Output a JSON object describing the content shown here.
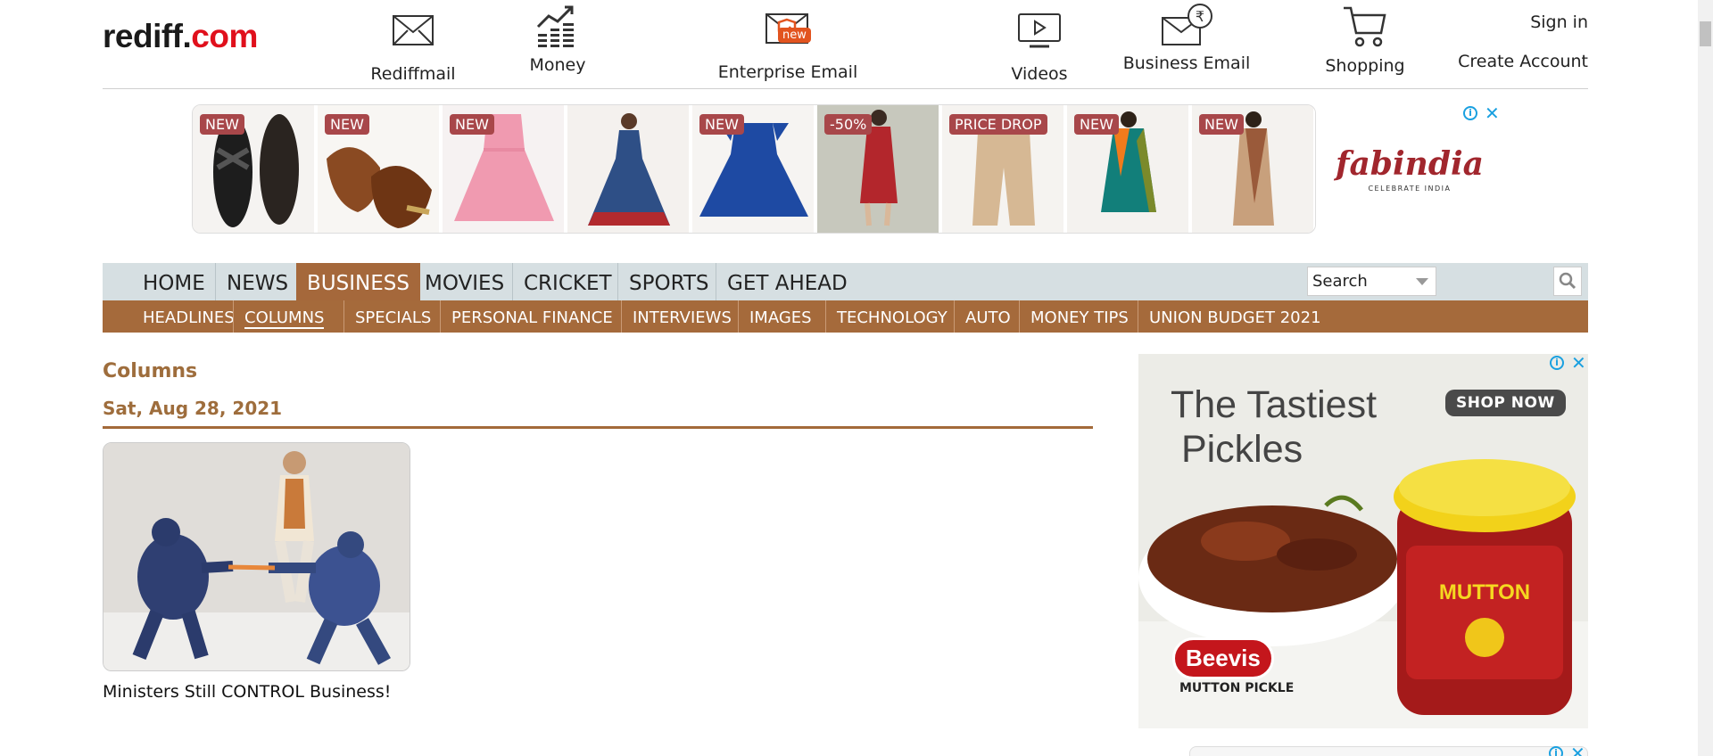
{
  "logo": {
    "part1": "rediff.",
    "part2": "com"
  },
  "header_nav": [
    {
      "label": "Rediffmail",
      "icon": "mail-icon"
    },
    {
      "label": "Money",
      "icon": "money-chart-icon"
    },
    {
      "label": "Enterprise Email",
      "icon": "enterprise-email-icon",
      "badge": "new"
    },
    {
      "label": "Videos",
      "icon": "video-icon"
    },
    {
      "label": "Business Email",
      "icon": "business-email-icon"
    },
    {
      "label": "Shopping",
      "icon": "cart-icon"
    }
  ],
  "account": {
    "signin": "Sign in",
    "create": "Create Account"
  },
  "top_ad": {
    "brand": "fabindia",
    "brand_sub": "CELEBRATE INDIA",
    "tiles": [
      {
        "tag": "NEW",
        "item": "sandals"
      },
      {
        "tag": "NEW",
        "item": "juttis"
      },
      {
        "tag": "NEW",
        "item": "girls-frock"
      },
      {
        "tag": "",
        "item": "anarkali"
      },
      {
        "tag": "NEW",
        "item": "blue-dress"
      },
      {
        "tag": "-50%",
        "item": "red-kurta"
      },
      {
        "tag": "PRICE DROP",
        "item": "trousers"
      },
      {
        "tag": "NEW",
        "item": "dupatta-outfit"
      },
      {
        "tag": "NEW",
        "item": "saree"
      }
    ]
  },
  "main_nav": [
    "HOME",
    "NEWS",
    "BUSINESS",
    "MOVIES",
    "CRICKET",
    "SPORTS",
    "GET AHEAD"
  ],
  "main_nav_active": "BUSINESS",
  "search": {
    "placeholder": "Search"
  },
  "sub_nav": [
    "HEADLINES",
    "COLUMNS",
    "SPECIALS",
    "PERSONAL FINANCE",
    "INTERVIEWS",
    "IMAGES",
    "TECHNOLOGY",
    "AUTO",
    "MONEY TIPS",
    "UNION BUDGET 2021"
  ],
  "sub_nav_active": "COLUMNS",
  "section": {
    "title": "Columns",
    "date": "Sat, Aug 28, 2021"
  },
  "articles": [
    {
      "title": "Ministers Still CONTROL Business!"
    }
  ],
  "side_ad": {
    "headline_line1": "The Tastiest",
    "headline_line2": " Pickles",
    "cta": "SHOP NOW",
    "brand": "Beevis",
    "brand_sub": "MUTTON PICKLE",
    "jar_label": "MUTTON"
  },
  "colors": {
    "accent": "#a5683b",
    "nav_bg": "#d6dfe2",
    "logo_red": "#e0101c",
    "heading": "#9e6d3c"
  }
}
